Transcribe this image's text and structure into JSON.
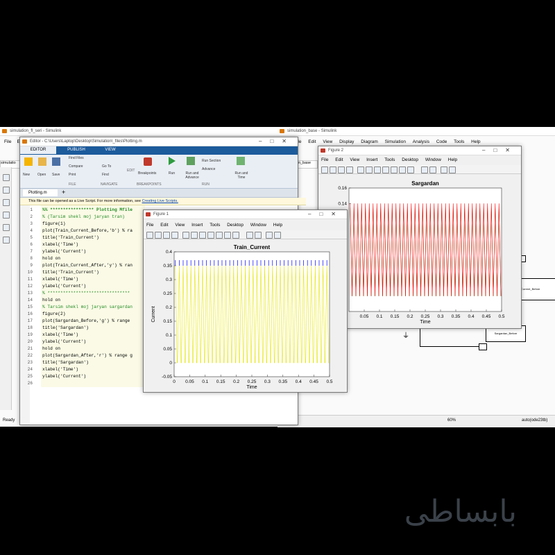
{
  "simulink_left": {
    "title": "simulation_fl_seri - Simulink",
    "menu": [
      "File",
      "Edi"
    ],
    "tab": "simulatio",
    "status": "Ready"
  },
  "simulink_right": {
    "title": "simulation_base - Simulink",
    "menu": [
      "File",
      "Edit",
      "View",
      "Display",
      "Diagram",
      "Simulation",
      "Analysis",
      "Code",
      "Tools",
      "Help"
    ],
    "tab": "on_base",
    "zoom": "60%",
    "solver": "auto(ode23tb)",
    "block_labels": [
      "Current_Before",
      "Sargardan_Before"
    ]
  },
  "editor": {
    "title": "Editor - C:\\Users\\Laptop\\Desktop\\Simulation\\_files\\Plotting.m",
    "ribbon_tabs": [
      "EDITOR",
      "PUBLISH",
      "VIEW"
    ],
    "file_buttons": [
      "New",
      "Open",
      "Save"
    ],
    "file_small": [
      "Find Files",
      "Compare",
      "Print"
    ],
    "nav_small": [
      "Go To",
      "Find"
    ],
    "edit_label": "EDIT",
    "breakpoints": "Breakpoints",
    "run": "Run",
    "run_advance": "Run and Advance",
    "run_section": "Run Section",
    "advance": "Advance",
    "run_time": "Run and Time",
    "group_labels": [
      "FILE",
      "NAVIGATE",
      "BREAKPOINTS",
      "RUN"
    ],
    "file_tab": "Plotting.m",
    "add_tab": "+",
    "info_text": "This file can be opened as a Live Script. For more information, see",
    "info_link": "Creating Live Scripts.",
    "lines": [
      {
        "t": "%% ***************** Plotting Mfile",
        "c": "#228b22",
        "b": true
      },
      {
        "t": "% (Tarsim shekl moj jaryan tran)",
        "c": "#228b22"
      },
      {
        "t": "figure(1)",
        "c": "#000"
      },
      {
        "t": "plot(Train_Current_Before,'b') % ra",
        "c": "#000"
      },
      {
        "t": "title('Train_Current')",
        "c": "#000"
      },
      {
        "t": "xlabel('Time')",
        "c": "#000"
      },
      {
        "t": "ylabel('Current')",
        "c": "#000"
      },
      {
        "t": "hold on",
        "c": "#000"
      },
      {
        "t": "plot(Train_Current_After,'y') % ran",
        "c": "#000"
      },
      {
        "t": "title('Train_Current')",
        "c": "#000"
      },
      {
        "t": "xlabel('Time')",
        "c": "#000"
      },
      {
        "t": "ylabel('Current')",
        "c": "#000"
      },
      {
        "t": "% ********************************",
        "c": "#228b22"
      },
      {
        "t": "hold on",
        "c": "#000"
      },
      {
        "t": "% Tarsim shekl moj jaryan sargardan",
        "c": "#228b22"
      },
      {
        "t": "figure(2)",
        "c": "#000"
      },
      {
        "t": "plot(Sargardan_Before,'g') % range",
        "c": "#000"
      },
      {
        "t": "title('Sargardan')",
        "c": "#000"
      },
      {
        "t": "xlabel('Time')",
        "c": "#000"
      },
      {
        "t": "ylabel('Current')",
        "c": "#000"
      },
      {
        "t": "hold on",
        "c": "#000"
      },
      {
        "t": "plot(Sargardan_After,'r') % range g",
        "c": "#000"
      },
      {
        "t": "title('Sargardan')",
        "c": "#000"
      },
      {
        "t": "xlabel('Time')",
        "c": "#000"
      },
      {
        "t": "ylabel('Current')",
        "c": "#000"
      },
      {
        "t": "",
        "c": "#000"
      }
    ]
  },
  "figure2": {
    "title": "Figure 2",
    "menu": [
      "File",
      "Edit",
      "View",
      "Insert",
      "Tools",
      "Desktop",
      "Window",
      "Help"
    ]
  },
  "figure1": {
    "title": "Figure 1",
    "menu": [
      "File",
      "Edit",
      "View",
      "Insert",
      "Tools",
      "Desktop",
      "Window",
      "Help"
    ]
  },
  "chart_data": [
    {
      "type": "line",
      "title": "Train_Current",
      "xlabel": "Time",
      "ylabel": "Current",
      "xlim": [
        0,
        0.5
      ],
      "ylim": [
        -0.05,
        0.4
      ],
      "xticks": [
        "0",
        "0.05",
        "0.1",
        "0.15",
        "0.2",
        "0.25",
        "0.3",
        "0.35",
        "0.4",
        "0.45",
        "0.5"
      ],
      "yticks": [
        "-0.05",
        "0",
        "0.05",
        "0.1",
        "0.15",
        "0.2",
        "0.25",
        "0.3",
        "0.35",
        "0.4"
      ],
      "series": [
        {
          "color": "#0000ff",
          "style": "spikes",
          "peak": 0.37,
          "base": 0.35,
          "period": 0.0125
        },
        {
          "color": "#e6e600",
          "style": "sawtooth",
          "max": 0.35,
          "min": 0.0,
          "period": 0.0125
        }
      ]
    },
    {
      "type": "line",
      "title": "Sargardan",
      "xlabel": "Time",
      "ylim": [
        0.0,
        0.16
      ],
      "xticks_visible": [
        "0.05",
        "0.1",
        "0.15",
        "0.2",
        "0.25",
        "0.3",
        "0.35",
        "0.4",
        "0.45",
        "0.5"
      ],
      "yticks_visible": [
        "0.16",
        "0.14"
      ],
      "series": [
        {
          "color": "#ff0000",
          "style": "sawtooth",
          "max": 0.14,
          "min": 0.0,
          "period": 0.0125
        },
        {
          "color": "#008000",
          "style": "sawtooth",
          "max": 0.135,
          "min": 0.0,
          "period": 0.0125
        }
      ]
    }
  ],
  "watermark": "بابساطی"
}
